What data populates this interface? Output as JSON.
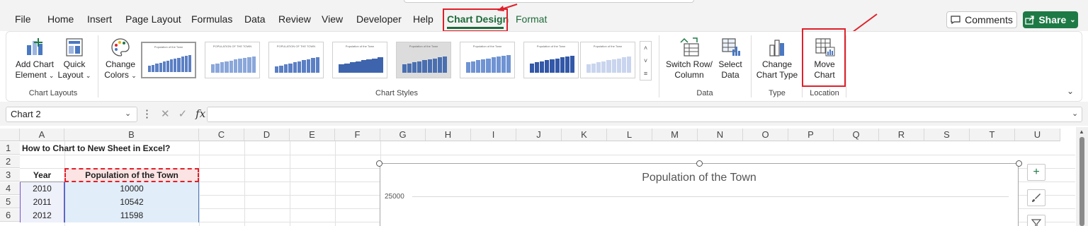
{
  "menu": {
    "tabs": [
      "File",
      "Home",
      "Insert",
      "Page Layout",
      "Formulas",
      "Data",
      "Review",
      "View",
      "Developer",
      "Help",
      "Chart Design",
      "Format"
    ],
    "active_tab": "Chart Design",
    "comments_label": "Comments",
    "share_label": "Share"
  },
  "ribbon": {
    "add_chart_element": [
      "Add Chart",
      "Element"
    ],
    "quick_layout": [
      "Quick",
      "Layout"
    ],
    "change_colors": [
      "Change",
      "Colors"
    ],
    "switch_row_column": [
      "Switch Row/",
      "Column"
    ],
    "select_data": [
      "Select",
      "Data"
    ],
    "change_chart_type": [
      "Change",
      "Chart Type"
    ],
    "move_chart": [
      "Move",
      "Chart"
    ],
    "groups": {
      "chart_layouts": "Chart Layouts",
      "chart_styles": "Chart Styles",
      "data": "Data",
      "type": "Type",
      "location": "Location"
    },
    "style_thumbnail_titles": [
      "Population of the Town",
      "POPULATION OF THE TOWN",
      "POPULATION OF THE TOWN",
      "Population of the Town",
      "Population of the Town",
      "Population of the Town",
      "Population of the Town",
      "Population of the Town"
    ]
  },
  "formula_bar": {
    "name_box": "Chart 2",
    "fx": "fx",
    "value": ""
  },
  "grid": {
    "columns": [
      "A",
      "B",
      "C",
      "D",
      "E",
      "F",
      "G",
      "H",
      "I",
      "J",
      "K",
      "L",
      "M",
      "N",
      "O",
      "P",
      "Q",
      "R",
      "S",
      "T",
      "U"
    ],
    "rows": [
      "1",
      "2",
      "3",
      "4",
      "5",
      "6"
    ],
    "a1": "How to Chart to New Sheet in Excel?",
    "header_year": "Year",
    "header_population": "Population of the Town",
    "data": [
      {
        "year": "2010",
        "population": "10000"
      },
      {
        "year": "2011",
        "population": "10542"
      },
      {
        "year": "2012",
        "population": "11598"
      }
    ]
  },
  "chart": {
    "title": "Population of the Town",
    "y_tick_top": "25000"
  },
  "colors": {
    "accent": "#1e6b3a",
    "highlight": "#e0202a",
    "share": "#1e7a45"
  }
}
